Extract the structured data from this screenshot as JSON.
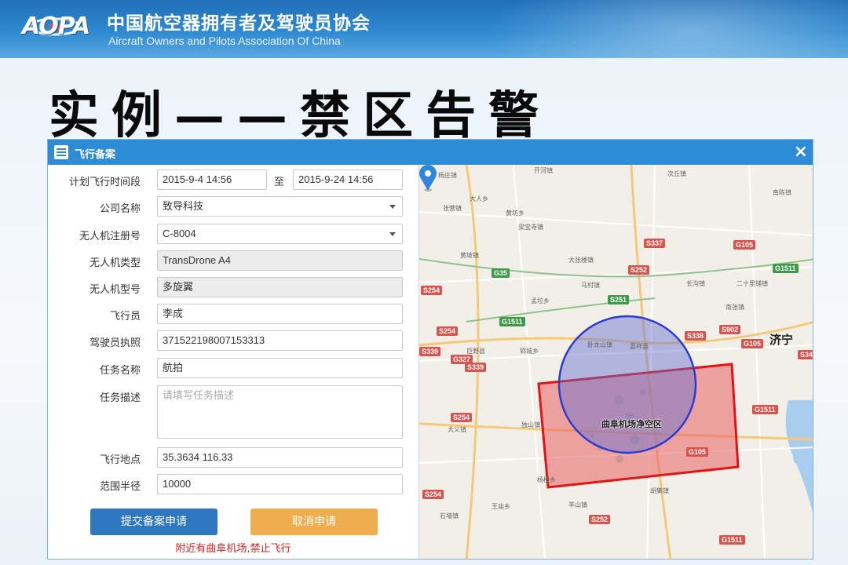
{
  "header": {
    "logo_text": "AOPA",
    "org_name_cn": "中国航空器拥有者及驾驶员协会",
    "org_name_en": "Aircraft Owners and Pilots Association Of China"
  },
  "page_title": "实例——禁区告警",
  "dialog": {
    "title": "飞行备案",
    "close_icon": "×",
    "form": {
      "time_label": "计划飞行时间段",
      "time_start": "2015-9-4 14:56",
      "time_to": "至",
      "time_end": "2015-9-24 14:56",
      "company_label": "公司名称",
      "company_value": "致导科技",
      "reg_label": "无人机注册号",
      "reg_value": "C-8004",
      "type_label": "无人机类型",
      "type_value": "TransDrone A4",
      "model_label": "无人机型号",
      "model_value": "多旋翼",
      "pilot_label": "飞行员",
      "pilot_value": "李成",
      "license_label": "驾驶员执照",
      "license_value": "371522198007153313",
      "task_name_label": "任务名称",
      "task_name_value": "航拍",
      "task_desc_label": "任务描述",
      "task_desc_placeholder": "请填写任务描述",
      "location_label": "飞行地点",
      "location_value": "35.3634 116.33",
      "radius_label": "范围半径",
      "radius_value": "10000",
      "submit_label": "提交备案申请",
      "cancel_label": "取消申请",
      "warning": "附近有曲阜机场,禁止飞行"
    },
    "map": {
      "zone_label": "曲阜机场净空区",
      "city_label": "济宁",
      "roads": [
        "G105",
        "G1511",
        "G35",
        "S337",
        "S252",
        "S254",
        "S338",
        "S902",
        "G327",
        "S339",
        "S251",
        "G1511",
        "S34",
        "G105",
        "S252"
      ],
      "towns": [
        "开河镇",
        "次丘镇",
        "杨庄镇",
        "大人乡",
        "南陈镇",
        "张营镇",
        "黄坊乡",
        "梁宝寺镇",
        "黄坡镇",
        "大张楼镇",
        "二十里铺镇",
        "马村镇",
        "长沟镇",
        "孟垃乡",
        "南张镇",
        "嘉祥县",
        "巨野县",
        "郓城乡",
        "卧龙山镇",
        "独山镇",
        "大义镇",
        "杨楼乡",
        "王庙乡",
        "羊山镇",
        "石墙镇",
        "胡集镇"
      ]
    }
  }
}
